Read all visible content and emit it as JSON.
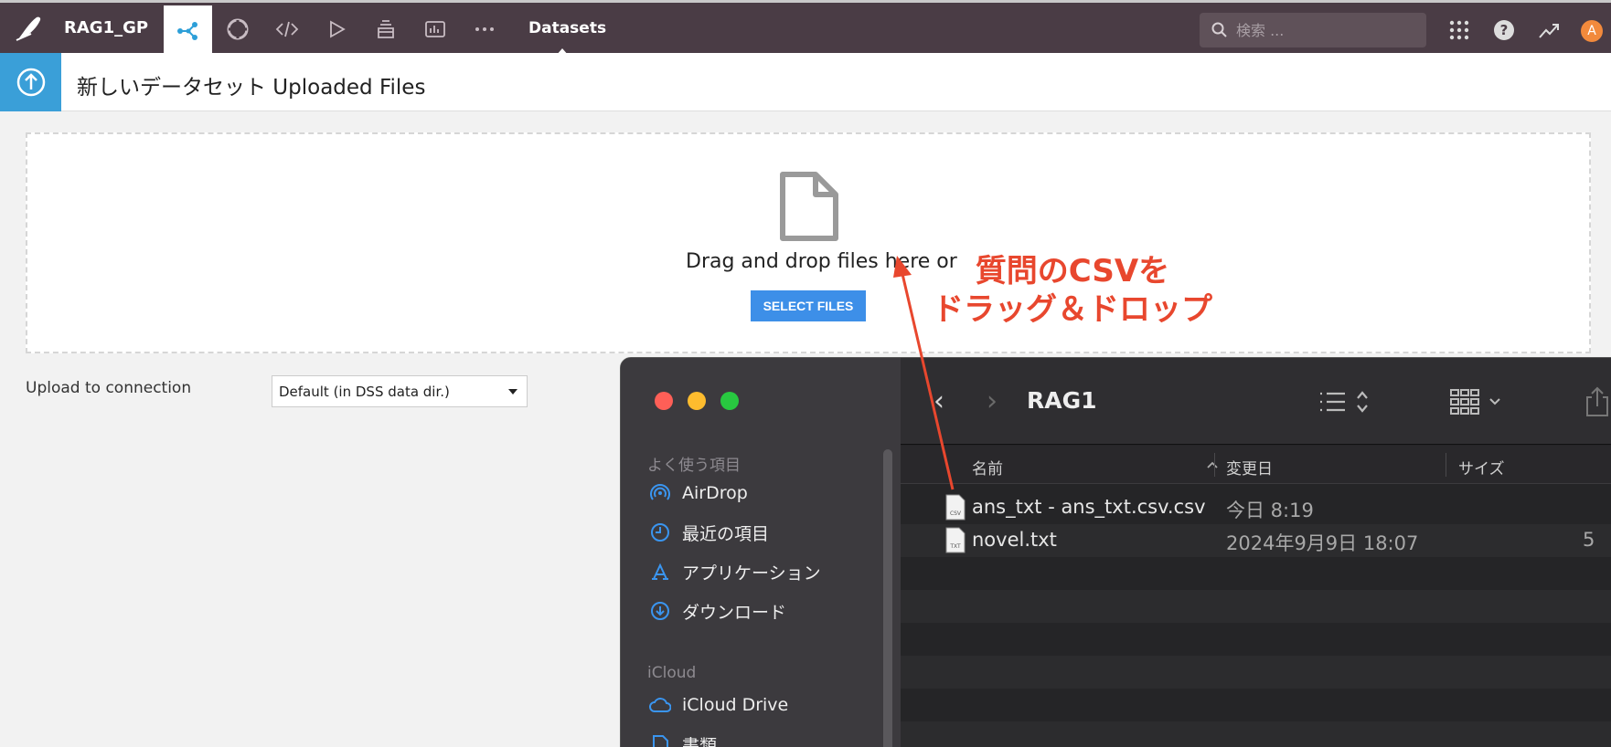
{
  "topbar": {
    "project": "RAG1_GP",
    "breadcrumb": "Datasets",
    "search_placeholder": "検索 ...",
    "avatar_letter": "A"
  },
  "header": {
    "title": "新しいデータセット Uploaded Files"
  },
  "dropzone": {
    "text": "Drag and drop files here or",
    "button": "SELECT FILES"
  },
  "connection": {
    "label": "Upload to connection",
    "value": "Default (in DSS data dir.)"
  },
  "annotation": {
    "line1": "質問のCSVを",
    "line2": "ドラッグ＆ドロップ",
    "color": "#e8472e"
  },
  "finder": {
    "favorites_label": "よく使う項目",
    "favorites": [
      {
        "label": "AirDrop",
        "icon": "airdrop-icon"
      },
      {
        "label": "最近の項目",
        "icon": "clock-icon"
      },
      {
        "label": "アプリケーション",
        "icon": "applications-icon"
      },
      {
        "label": "ダウンロード",
        "icon": "download-icon"
      }
    ],
    "icloud_label": "iCloud",
    "icloud": [
      {
        "label": "iCloud Drive",
        "icon": "cloud-icon"
      },
      {
        "label": "書類",
        "icon": "document-icon"
      }
    ],
    "folder": "RAG1",
    "columns": {
      "name": "名前",
      "modified": "変更日",
      "size": "サイズ"
    },
    "files": [
      {
        "name": "ans_txt - ans_txt.csv.csv",
        "date": "今日 8:19",
        "size": "",
        "badge": "CSV"
      },
      {
        "name": "novel.txt",
        "date": "2024年9月9日 18:07",
        "size": "5",
        "badge": "TXT"
      }
    ]
  }
}
